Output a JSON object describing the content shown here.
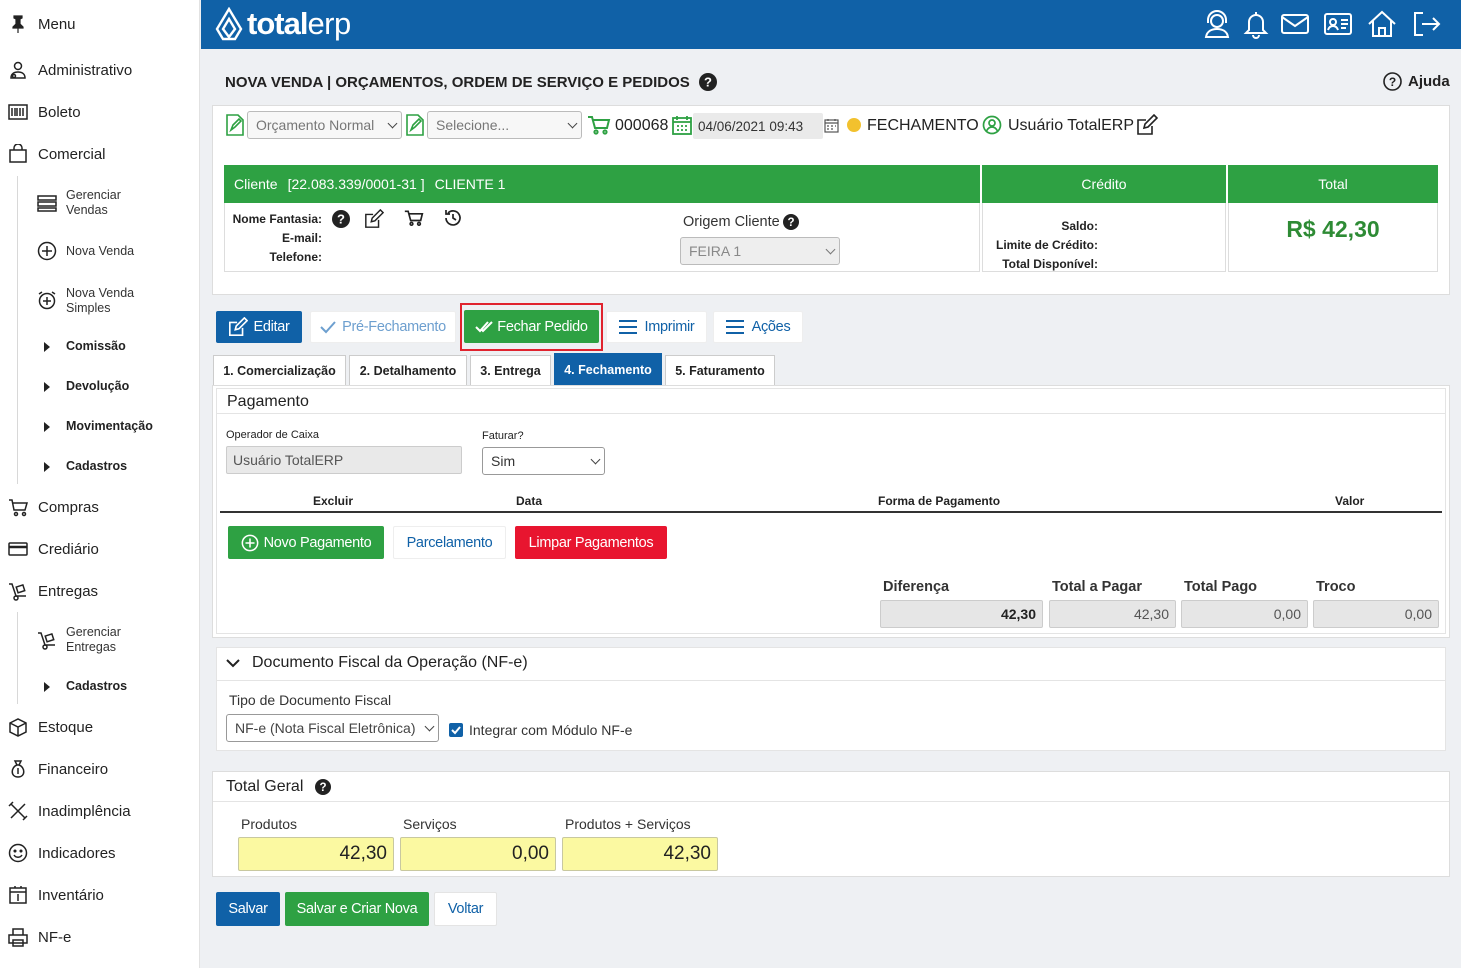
{
  "sidebar": {
    "menu_label": "Menu",
    "items": [
      {
        "label": "Administrativo",
        "icon": "users-icon"
      },
      {
        "label": "Boleto",
        "icon": "barcode-icon"
      },
      {
        "label": "Comercial",
        "icon": "shopping-bag-icon"
      },
      {
        "label": "Compras",
        "icon": "cart-icon"
      },
      {
        "label": "Crediário",
        "icon": "credit-card-icon"
      },
      {
        "label": "Entregas",
        "icon": "hand-truck-icon"
      },
      {
        "label": "Estoque",
        "icon": "box-icon"
      },
      {
        "label": "Financeiro",
        "icon": "money-bag-icon"
      },
      {
        "label": "Inadimplência",
        "icon": "tools-icon"
      },
      {
        "label": "Indicadores",
        "icon": "smiley-icon"
      },
      {
        "label": "Inventário",
        "icon": "inventory-icon"
      },
      {
        "label": "NF-e",
        "icon": "printer-icon"
      }
    ],
    "comercial_sub": [
      "Gerenciar Vendas",
      "Nova Venda",
      "Nova Venda Simples"
    ],
    "comercial_groups": [
      "Comissão",
      "Devolução",
      "Movimentação",
      "Cadastros"
    ],
    "entregas_sub": [
      "Gerenciar Entregas"
    ],
    "entregas_groups": [
      "Cadastros"
    ]
  },
  "topbar": {
    "logo_bold": "total",
    "logo_light": "erp",
    "brand_color": "#1061a7"
  },
  "page": {
    "title": "NOVA VENDA | ORÇAMENTOS, ORDEM DE SERVIÇO E PEDIDOS",
    "help": "Ajuda"
  },
  "order_bar": {
    "type_select": "Orçamento Normal",
    "second_select": "Selecione...",
    "number": "000068",
    "datetime": "04/06/2021 09:43",
    "status": "FECHAMENTO",
    "status_color": "#f2c12e",
    "user": "Usuário TotalERP"
  },
  "client": {
    "header_label": "Cliente",
    "document": "[22.083.339/0001-31 ]",
    "name": "CLIENTE 1",
    "nome_fantasia": "Nome Fantasia:",
    "email": "E-mail:",
    "telefone": "Telefone:",
    "origem_label": "Origem Cliente",
    "origem_value": "FEIRA 1"
  },
  "credit": {
    "header": "Crédito",
    "saldo": "Saldo:",
    "limite": "Limite de Crédito:",
    "disponivel": "Total Disponível:"
  },
  "total_box": {
    "header": "Total",
    "value": "R$ 42,30"
  },
  "actions": {
    "editar": "Editar",
    "pre_fechamento": "Pré-Fechamento",
    "fechar_pedido": "Fechar Pedido",
    "imprimir": "Imprimir",
    "acoes": "Ações"
  },
  "tabs": [
    "1. Comercialização",
    "2. Detalhamento",
    "3. Entrega",
    "4. Fechamento",
    "5. Faturamento"
  ],
  "pagamento": {
    "title": "Pagamento",
    "operador_label": "Operador de Caixa",
    "operador_value": "Usuário TotalERP",
    "faturar_label": "Faturar?",
    "faturar_value": "Sim",
    "columns": [
      "Excluir",
      "Data",
      "Forma de Pagamento",
      "Valor"
    ],
    "novo_pagamento": "Novo Pagamento",
    "parcelamento": "Parcelamento",
    "limpar": "Limpar Pagamentos",
    "diferenca_label": "Diferença",
    "diferenca": "42,30",
    "total_pagar_label": "Total a Pagar",
    "total_pagar": "42,30",
    "total_pago_label": "Total Pago",
    "total_pago": "0,00",
    "troco_label": "Troco",
    "troco": "0,00"
  },
  "nfe": {
    "title": "Documento Fiscal da Operação (NF-e)",
    "tipo_label": "Tipo de Documento Fiscal",
    "tipo_value": "NF-e (Nota Fiscal Eletrônica)",
    "integrar_label": "Integrar com Módulo NF-e",
    "integrar_checked": true
  },
  "total_geral": {
    "title": "Total Geral",
    "produtos_label": "Produtos",
    "produtos": "42,30",
    "servicos_label": "Serviços",
    "servicos": "0,00",
    "prod_serv_label": "Produtos + Serviços",
    "prod_serv": "42,30"
  },
  "footer": {
    "salvar": "Salvar",
    "salvar_criar": "Salvar e Criar Nova",
    "voltar": "Voltar"
  }
}
